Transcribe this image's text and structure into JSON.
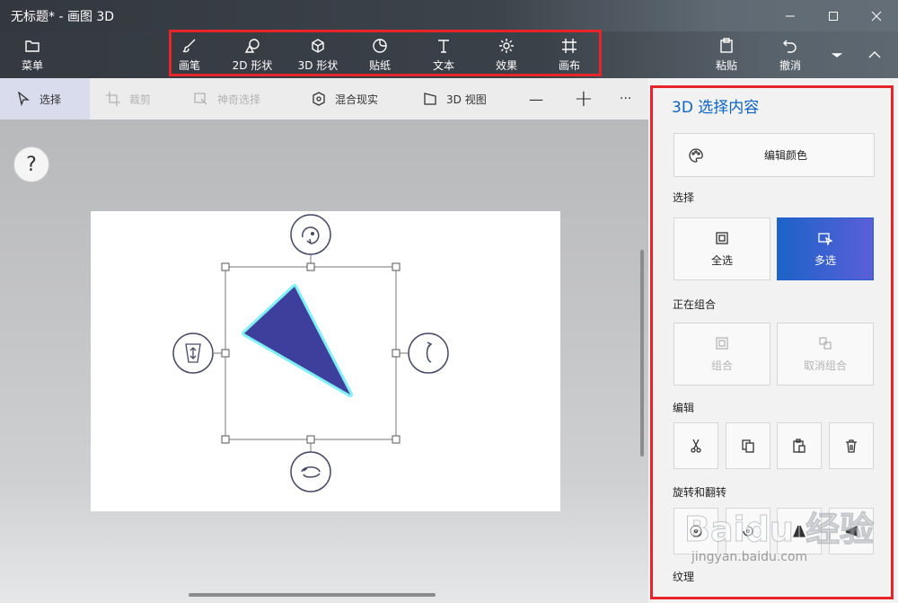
{
  "window": {
    "title": "无标题* - 画图 3D"
  },
  "toolbar": {
    "menu_label": "菜单",
    "tools": [
      {
        "label": "画笔",
        "icon": "brush-icon"
      },
      {
        "label": "2D 形状",
        "icon": "shapes-2d-icon"
      },
      {
        "label": "3D 形状",
        "icon": "cube-icon"
      },
      {
        "label": "贴纸",
        "icon": "sticker-icon"
      },
      {
        "label": "文本",
        "icon": "text-icon"
      },
      {
        "label": "效果",
        "icon": "sun-icon"
      },
      {
        "label": "画布",
        "icon": "canvas-icon"
      }
    ],
    "paste_label": "粘贴",
    "undo_label": "撤消"
  },
  "subbar": {
    "select": "选择",
    "crop": "裁剪",
    "magic_select": "神奇选择",
    "mixed_reality": "混合现实",
    "view_3d": "3D 视图",
    "zoom_out": "—",
    "zoom_in": "+",
    "more": "···"
  },
  "canvas": {
    "help": "?"
  },
  "panel": {
    "title": "3D 选择内容",
    "edit_color": "编辑颜色",
    "section_select": "选择",
    "select_all": "全选",
    "multi_select": "多选",
    "section_group": "正在组合",
    "group": "组合",
    "ungroup": "取消组合",
    "section_edit": "编辑",
    "section_rotate": "旋转和翻转",
    "section_texture": "纹理"
  },
  "watermark": {
    "text": "Baidu 经验",
    "sub": "jingyan.baidu.com"
  },
  "colors": {
    "accent": "#0b63c5",
    "highlight": "#e8242b",
    "triangle": "#3e3f9d",
    "triangle_glow": "#7ff0f5"
  }
}
